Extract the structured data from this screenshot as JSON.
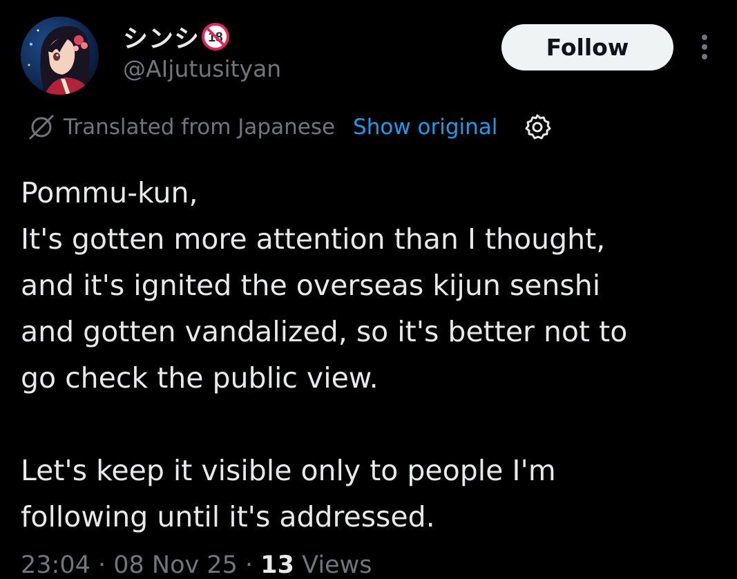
{
  "author": {
    "display_name": "シンシ",
    "badge_text": "18",
    "handle": "@AIjutusityan"
  },
  "header": {
    "follow_label": "Follow",
    "more_icon": "more-vertical-icon"
  },
  "translation": {
    "icon": "translate-icon",
    "label": "Translated from Japanese",
    "show_original_label": "Show original",
    "settings_icon": "gear-icon"
  },
  "tweet": {
    "lines": [
      "Pommu-kun,",
      "It's gotten more attention than I thought,",
      "and it's ignited the overseas kijun senshi",
      "and gotten vandalized, so it's better not to",
      "go check the public view.",
      "",
      "Let's keep it visible only to people I'm",
      "following until it's addressed."
    ]
  },
  "meta": {
    "time": "23:04",
    "separator": " · ",
    "date": "08 Nov 25",
    "views_count": "13",
    "views_label": "Views"
  },
  "colors": {
    "background": "#000000",
    "text_primary": "#e7e9ea",
    "text_secondary": "#71767b",
    "link": "#1d9bf0",
    "follow_bg": "#eff3f4"
  }
}
